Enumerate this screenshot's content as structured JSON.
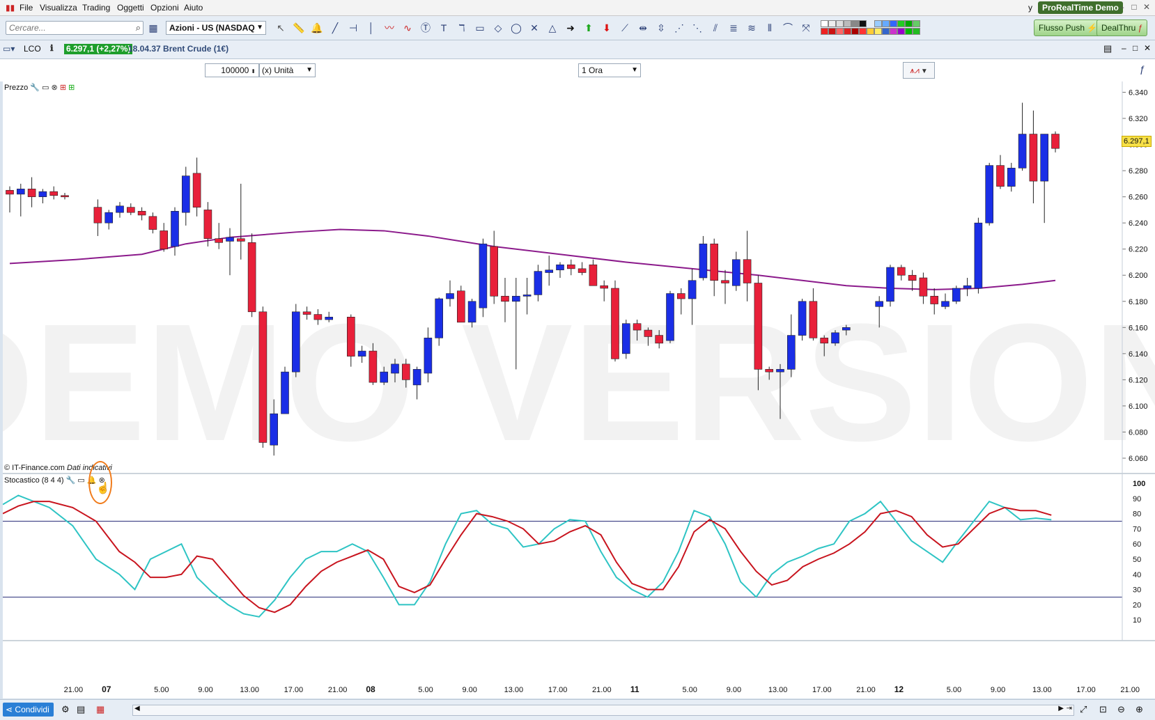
{
  "menu": {
    "items": [
      "File",
      "Visualizza",
      "Trading",
      "Oggetti",
      "Opzioni",
      "Aiuto"
    ],
    "user_initial": "y",
    "brand": "ProRealTime",
    "brand_suffix": "Demo"
  },
  "toolbar": {
    "search_placeholder": "Cercare...",
    "market_select": "Azioni - US (NASDAQ",
    "flusso_push": "Flusso Push",
    "dealthru": "DealThru"
  },
  "chart_header": {
    "symbol": "LCO",
    "price_badge": "6.297,1 (+2,27%)",
    "time_and_name": "18.04.37 Brent Crude (1€)"
  },
  "controls": {
    "quantity": "100000",
    "unit_select": "(x) Unità",
    "timeframe_select": "1 Ora"
  },
  "price_panel": {
    "label": "Prezzo",
    "watermark": "DEMO VERSION",
    "copyright": "© IT-Finance.com",
    "data_note": "Dati indicativi",
    "last_price_tag": "6.297,1",
    "accent_up": "#1a2ee6",
    "accent_down": "#e8203a",
    "ma_color": "#8b1a8b"
  },
  "stoch_panel": {
    "label": "Stocastico (8 4 4)",
    "k_color": "#2ec4c4",
    "d_color": "#c8141e"
  },
  "bottom": {
    "share_label": "Condividi"
  },
  "chart_data": {
    "type": "candlestick",
    "timeframe": "1 Ora",
    "price_axis": {
      "ticks": [
        "6.340",
        "6.320",
        "6.300",
        "6.280",
        "6.260",
        "6.240",
        "6.220",
        "6.200",
        "6.180",
        "6.160",
        "6.140",
        "6.120",
        "6.100",
        "6.080",
        "6.060"
      ],
      "ylim": [
        6.052,
        6.344
      ]
    },
    "stoch_axis": {
      "ticks": [
        "100",
        "90",
        "80",
        "70",
        "60",
        "50",
        "40",
        "30",
        "20",
        "10"
      ],
      "levels": [
        75,
        25
      ]
    },
    "x_ticks": [
      {
        "t": 3,
        "label": "21.00",
        "bold": false
      },
      {
        "t": 6,
        "label": "07",
        "bold": true
      },
      {
        "t": 11,
        "label": "5.00",
        "bold": false
      },
      {
        "t": 15,
        "label": "9.00",
        "bold": false
      },
      {
        "t": 19,
        "label": "13.00",
        "bold": false
      },
      {
        "t": 23,
        "label": "17.00",
        "bold": false
      },
      {
        "t": 27,
        "label": "21.00",
        "bold": false
      },
      {
        "t": 30,
        "label": "08",
        "bold": true
      },
      {
        "t": 35,
        "label": "5.00",
        "bold": false
      },
      {
        "t": 39,
        "label": "9.00",
        "bold": false
      },
      {
        "t": 43,
        "label": "13.00",
        "bold": false
      },
      {
        "t": 47,
        "label": "17.00",
        "bold": false
      },
      {
        "t": 51,
        "label": "21.00",
        "bold": false
      },
      {
        "t": 54,
        "label": "11",
        "bold": true
      },
      {
        "t": 59,
        "label": "5.00",
        "bold": false
      },
      {
        "t": 63,
        "label": "9.00",
        "bold": false
      },
      {
        "t": 67,
        "label": "13.00",
        "bold": false
      },
      {
        "t": 71,
        "label": "17.00",
        "bold": false
      },
      {
        "t": 75,
        "label": "21.00",
        "bold": false
      },
      {
        "t": 78,
        "label": "12",
        "bold": true
      },
      {
        "t": 83,
        "label": "5.00",
        "bold": false
      },
      {
        "t": 87,
        "label": "9.00",
        "bold": false
      },
      {
        "t": 91,
        "label": "13.00",
        "bold": false
      },
      {
        "t": 95,
        "label": "17.00",
        "bold": false
      },
      {
        "t": 99,
        "label": "21.00",
        "bold": false
      }
    ],
    "candles": [
      [
        0,
        6.265,
        6.268,
        6.248,
        6.262
      ],
      [
        1,
        6.262,
        6.27,
        6.245,
        6.266
      ],
      [
        2,
        6.266,
        6.275,
        6.252,
        6.26
      ],
      [
        3,
        6.26,
        6.266,
        6.255,
        6.264
      ],
      [
        4,
        6.264,
        6.268,
        6.258,
        6.261
      ],
      [
        5,
        6.261,
        6.263,
        6.258,
        6.26
      ],
      [
        8,
        6.252,
        6.258,
        6.23,
        6.24
      ],
      [
        9,
        6.24,
        6.25,
        6.235,
        6.248
      ],
      [
        10,
        6.248,
        6.256,
        6.244,
        6.253
      ],
      [
        11,
        6.252,
        6.255,
        6.246,
        6.248
      ],
      [
        12,
        6.249,
        6.252,
        6.242,
        6.246
      ],
      [
        13,
        6.245,
        6.248,
        6.232,
        6.235
      ],
      [
        14,
        6.234,
        6.24,
        6.218,
        6.22
      ],
      [
        15,
        6.222,
        6.252,
        6.215,
        6.249
      ],
      [
        16,
        6.248,
        6.283,
        6.238,
        6.276
      ],
      [
        17,
        6.278,
        6.29,
        6.245,
        6.252
      ],
      [
        18,
        6.25,
        6.256,
        6.222,
        6.228
      ],
      [
        19,
        6.228,
        6.24,
        6.22,
        6.225
      ],
      [
        20,
        6.226,
        6.236,
        6.2,
        6.229
      ],
      [
        21,
        6.228,
        6.27,
        6.212,
        6.226
      ],
      [
        22,
        6.225,
        6.232,
        6.168,
        6.172
      ],
      [
        23,
        6.172,
        6.176,
        6.068,
        6.072
      ],
      [
        24,
        6.07,
        6.105,
        6.062,
        6.094
      ],
      [
        25,
        6.094,
        6.13,
        6.094,
        6.126
      ],
      [
        26,
        6.126,
        6.178,
        6.122,
        6.172
      ],
      [
        27,
        6.172,
        6.176,
        6.166,
        6.17
      ],
      [
        28,
        6.17,
        6.174,
        6.162,
        6.166
      ],
      [
        29,
        6.166,
        6.172,
        6.164,
        6.168
      ],
      [
        31,
        6.168,
        6.17,
        6.13,
        6.138
      ],
      [
        32,
        6.138,
        6.146,
        6.133,
        6.142
      ],
      [
        33,
        6.142,
        6.148,
        6.116,
        6.118
      ],
      [
        34,
        6.118,
        6.13,
        6.116,
        6.126
      ],
      [
        35,
        6.125,
        6.136,
        6.118,
        6.132
      ],
      [
        36,
        6.132,
        6.136,
        6.114,
        6.12
      ],
      [
        37,
        6.116,
        6.13,
        6.105,
        6.128
      ],
      [
        38,
        6.125,
        6.16,
        6.118,
        6.152
      ],
      [
        39,
        6.152,
        6.183,
        6.146,
        6.182
      ],
      [
        40,
        6.182,
        6.196,
        6.176,
        6.186
      ],
      [
        41,
        6.188,
        6.192,
        6.164,
        6.164
      ],
      [
        42,
        6.164,
        6.182,
        6.16,
        6.18
      ],
      [
        43,
        6.175,
        6.228,
        6.168,
        6.224
      ],
      [
        44,
        6.222,
        6.234,
        6.178,
        6.184
      ],
      [
        45,
        6.184,
        6.198,
        6.164,
        6.18
      ],
      [
        46,
        6.18,
        6.198,
        6.128,
        6.184
      ],
      [
        47,
        6.184,
        6.198,
        6.17,
        6.185
      ],
      [
        48,
        6.185,
        6.208,
        6.18,
        6.203
      ],
      [
        49,
        6.202,
        6.215,
        6.192,
        6.204
      ],
      [
        50,
        6.204,
        6.21,
        6.198,
        6.208
      ],
      [
        51,
        6.208,
        6.212,
        6.2,
        6.205
      ],
      [
        52,
        6.205,
        6.21,
        6.2,
        6.202
      ],
      [
        53,
        6.208,
        6.212,
        6.192,
        6.192
      ],
      [
        54,
        6.192,
        6.196,
        6.18,
        6.19
      ],
      [
        55,
        6.19,
        6.196,
        6.134,
        6.136
      ],
      [
        56,
        6.14,
        6.166,
        6.136,
        6.163
      ],
      [
        57,
        6.163,
        6.166,
        6.15,
        6.158
      ],
      [
        58,
        6.158,
        6.16,
        6.146,
        6.153
      ],
      [
        59,
        6.154,
        6.158,
        6.144,
        6.148
      ],
      [
        60,
        6.15,
        6.188,
        6.148,
        6.186
      ],
      [
        61,
        6.186,
        6.19,
        6.17,
        6.182
      ],
      [
        62,
        6.182,
        6.205,
        6.162,
        6.196
      ],
      [
        63,
        6.198,
        6.23,
        6.196,
        6.224
      ],
      [
        64,
        6.224,
        6.228,
        6.184,
        6.196
      ],
      [
        65,
        6.196,
        6.204,
        6.178,
        6.194
      ],
      [
        66,
        6.192,
        6.218,
        6.188,
        6.212
      ],
      [
        67,
        6.212,
        6.234,
        6.18,
        6.194
      ],
      [
        68,
        6.194,
        6.2,
        6.112,
        6.128
      ],
      [
        69,
        6.128,
        6.13,
        6.12,
        6.126
      ],
      [
        70,
        6.126,
        6.132,
        6.09,
        6.128
      ],
      [
        71,
        6.128,
        6.17,
        6.122,
        6.154
      ],
      [
        72,
        6.154,
        6.182,
        6.15,
        6.18
      ],
      [
        73,
        6.18,
        6.19,
        6.15,
        6.152
      ],
      [
        74,
        6.152,
        6.154,
        6.138,
        6.148
      ],
      [
        75,
        6.148,
        6.158,
        6.146,
        6.156
      ],
      [
        76,
        6.158,
        6.162,
        6.154,
        6.16
      ],
      [
        79,
        6.176,
        6.184,
        6.16,
        6.18
      ],
      [
        80,
        6.18,
        6.208,
        6.176,
        6.206
      ],
      [
        81,
        6.206,
        6.208,
        6.196,
        6.2
      ],
      [
        82,
        6.2,
        6.204,
        6.188,
        6.196
      ],
      [
        83,
        6.198,
        6.202,
        6.178,
        6.184
      ],
      [
        84,
        6.184,
        6.19,
        6.17,
        6.178
      ],
      [
        85,
        6.176,
        6.186,
        6.174,
        6.18
      ],
      [
        86,
        6.18,
        6.192,
        6.178,
        6.19
      ],
      [
        87,
        6.19,
        6.198,
        6.184,
        6.192
      ],
      [
        88,
        6.19,
        6.244,
        6.186,
        6.24
      ],
      [
        89,
        6.24,
        6.286,
        6.238,
        6.284
      ],
      [
        90,
        6.284,
        6.292,
        6.266,
        6.268
      ],
      [
        91,
        6.268,
        6.286,
        6.264,
        6.282
      ],
      [
        92,
        6.282,
        6.332,
        6.28,
        6.308
      ],
      [
        93,
        6.308,
        6.326,
        6.255,
        6.272
      ],
      [
        94,
        6.272,
        6.308,
        6.24,
        6.308
      ],
      [
        95,
        6.308,
        6.31,
        6.294,
        6.297
      ]
    ],
    "moving_average": [
      [
        0,
        6.209
      ],
      [
        6,
        6.212
      ],
      [
        12,
        6.216
      ],
      [
        16,
        6.224
      ],
      [
        20,
        6.229
      ],
      [
        26,
        6.233
      ],
      [
        30,
        6.235
      ],
      [
        34,
        6.234
      ],
      [
        38,
        6.23
      ],
      [
        44,
        6.222
      ],
      [
        50,
        6.216
      ],
      [
        56,
        6.21
      ],
      [
        62,
        6.205
      ],
      [
        68,
        6.2
      ],
      [
        72,
        6.196
      ],
      [
        76,
        6.192
      ],
      [
        80,
        6.19
      ],
      [
        84,
        6.189
      ],
      [
        88,
        6.19
      ],
      [
        92,
        6.193
      ],
      [
        95,
        6.196
      ]
    ],
    "stoch_k": [
      [
        0,
        86
      ],
      [
        2,
        92
      ],
      [
        4,
        88
      ],
      [
        6,
        84
      ],
      [
        9,
        72
      ],
      [
        12,
        50
      ],
      [
        15,
        40
      ],
      [
        17,
        30
      ],
      [
        19,
        50
      ],
      [
        21,
        55
      ],
      [
        23,
        60
      ],
      [
        25,
        38
      ],
      [
        27,
        28
      ],
      [
        29,
        20
      ],
      [
        31,
        14
      ],
      [
        33,
        12
      ],
      [
        35,
        23
      ],
      [
        37,
        38
      ],
      [
        39,
        50
      ],
      [
        41,
        55
      ],
      [
        43,
        55
      ],
      [
        45,
        60
      ],
      [
        47,
        55
      ],
      [
        49,
        38
      ],
      [
        51,
        20
      ],
      [
        53,
        20
      ],
      [
        55,
        35
      ],
      [
        57,
        60
      ],
      [
        59,
        80
      ],
      [
        61,
        82
      ],
      [
        63,
        73
      ],
      [
        65,
        70
      ],
      [
        67,
        58
      ],
      [
        69,
        60
      ],
      [
        71,
        70
      ],
      [
        73,
        76
      ],
      [
        75,
        75
      ],
      [
        77,
        55
      ],
      [
        79,
        38
      ],
      [
        81,
        30
      ],
      [
        83,
        25
      ],
      [
        85,
        35
      ],
      [
        87,
        55
      ],
      [
        89,
        82
      ],
      [
        91,
        78
      ],
      [
        93,
        60
      ],
      [
        95,
        35
      ],
      [
        97,
        25
      ],
      [
        99,
        40
      ],
      [
        101,
        48
      ],
      [
        103,
        52
      ],
      [
        105,
        57
      ],
      [
        107,
        60
      ],
      [
        109,
        75
      ],
      [
        111,
        80
      ],
      [
        113,
        88
      ],
      [
        115,
        75
      ],
      [
        117,
        62
      ],
      [
        119,
        55
      ],
      [
        121,
        48
      ],
      [
        123,
        62
      ],
      [
        125,
        75
      ],
      [
        127,
        88
      ],
      [
        129,
        84
      ],
      [
        131,
        76
      ],
      [
        133,
        77
      ],
      [
        135,
        76
      ]
    ],
    "stoch_d": [
      [
        0,
        80
      ],
      [
        2,
        85
      ],
      [
        4,
        88
      ],
      [
        6,
        88
      ],
      [
        9,
        84
      ],
      [
        12,
        75
      ],
      [
        15,
        55
      ],
      [
        17,
        48
      ],
      [
        19,
        38
      ],
      [
        21,
        38
      ],
      [
        23,
        40
      ],
      [
        25,
        52
      ],
      [
        27,
        50
      ],
      [
        29,
        38
      ],
      [
        31,
        26
      ],
      [
        33,
        18
      ],
      [
        35,
        15
      ],
      [
        37,
        20
      ],
      [
        39,
        32
      ],
      [
        41,
        42
      ],
      [
        43,
        48
      ],
      [
        45,
        52
      ],
      [
        47,
        56
      ],
      [
        49,
        50
      ],
      [
        51,
        32
      ],
      [
        53,
        28
      ],
      [
        55,
        33
      ],
      [
        57,
        50
      ],
      [
        59,
        66
      ],
      [
        61,
        80
      ],
      [
        63,
        78
      ],
      [
        65,
        75
      ],
      [
        67,
        70
      ],
      [
        69,
        60
      ],
      [
        71,
        62
      ],
      [
        73,
        68
      ],
      [
        75,
        72
      ],
      [
        77,
        66
      ],
      [
        79,
        48
      ],
      [
        81,
        34
      ],
      [
        83,
        30
      ],
      [
        85,
        30
      ],
      [
        87,
        45
      ],
      [
        89,
        68
      ],
      [
        91,
        76
      ],
      [
        93,
        70
      ],
      [
        95,
        55
      ],
      [
        97,
        42
      ],
      [
        99,
        33
      ],
      [
        101,
        36
      ],
      [
        103,
        45
      ],
      [
        105,
        50
      ],
      [
        107,
        54
      ],
      [
        109,
        60
      ],
      [
        111,
        68
      ],
      [
        113,
        80
      ],
      [
        115,
        82
      ],
      [
        117,
        78
      ],
      [
        119,
        66
      ],
      [
        121,
        58
      ],
      [
        123,
        60
      ],
      [
        125,
        70
      ],
      [
        127,
        80
      ],
      [
        129,
        84
      ],
      [
        131,
        82
      ],
      [
        133,
        82
      ],
      [
        135,
        79
      ]
    ]
  }
}
